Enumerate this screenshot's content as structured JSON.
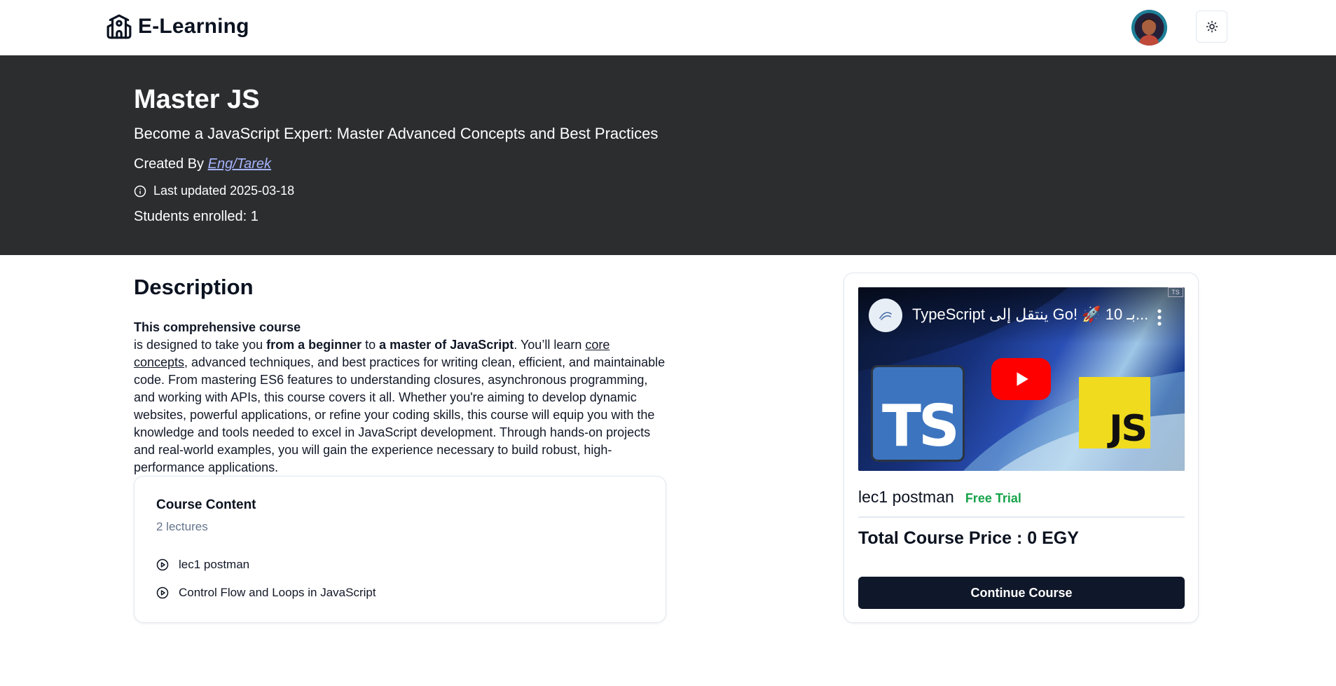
{
  "header": {
    "brand": "E-Learning",
    "brand_icon": "school-icon",
    "avatar_icon": "avatar",
    "theme_icon": "sun-icon"
  },
  "course": {
    "title": "Master JS",
    "subtitle": "Become a JavaScript Expert: Master Advanced Concepts and Best Practices",
    "created_by_label": "Created By",
    "author": "Eng/Tarek",
    "last_updated": "Last updated 2025-03-18",
    "students_enrolled": "Students enrolled: 1"
  },
  "description": {
    "heading": "Description",
    "lead": "This comprehensive course",
    "p1": "is designed to take you ",
    "b1": "from a beginner",
    "p2": " to ",
    "b2": "a master of JavaScript",
    "p3": ". You’ll learn ",
    "u1": "core concepts",
    "p4": ", advanced techniques, and best practices for writing clean, efficient, and maintainable code. From mastering ES6 features to understanding closures, asynchronous programming, and working with APIs, this course covers it all. Whether you're aiming to develop dynamic websites, powerful applications, or refine your coding skills, this course will equip you with the knowledge and tools needed to excel in JavaScript development. Through hands-on projects and real-world examples, you will gain the experience necessary to build robust, high-performance applications."
  },
  "content": {
    "title": "Course Content",
    "count": "2 lectures",
    "lectures": [
      {
        "label": "lec1 postman"
      },
      {
        "label": "Control Flow and Loops in JavaScript"
      }
    ]
  },
  "sidebar": {
    "video": {
      "title": "TypeScript ينتقل إلى Go! 🚀 10 بـ...",
      "left_logo": "TS",
      "right_logo": "JS",
      "corner_tag": "TS"
    },
    "lecture_name": "lec1 postman",
    "badge": "Free Trial",
    "price": "Total Course Price : 0 EGY",
    "cta": "Continue Course"
  },
  "colors": {
    "hero_bg": "#2c2d2f",
    "button_bg": "#0f172a",
    "badge": "#16a34a",
    "link": "#a5b4fc"
  }
}
